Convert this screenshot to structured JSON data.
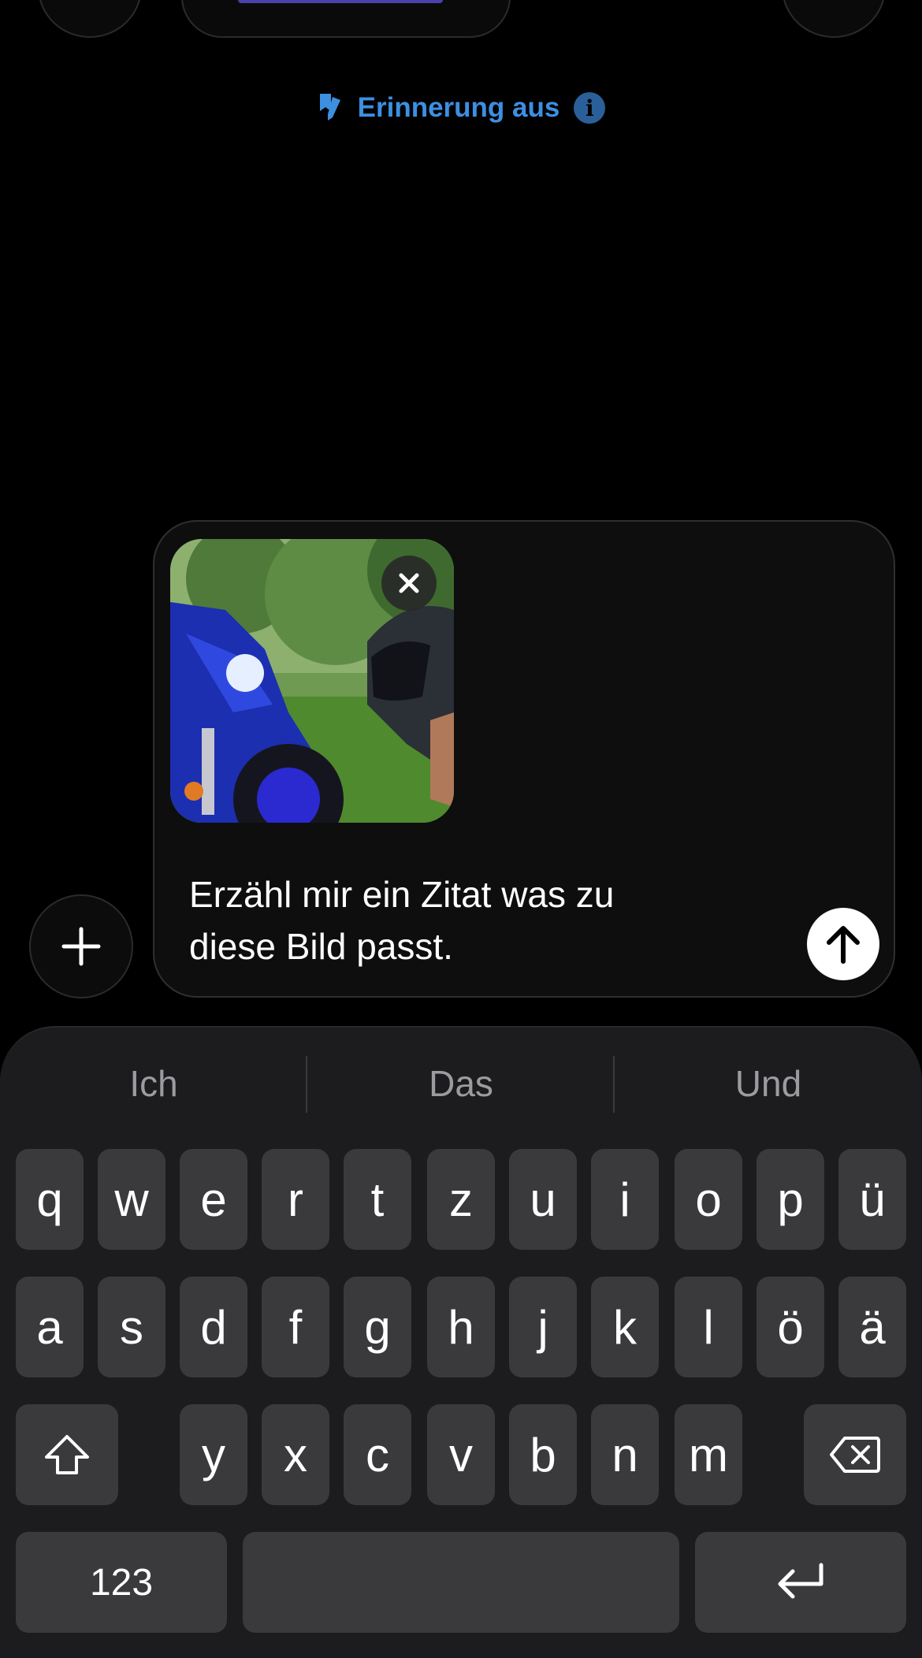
{
  "memory": {
    "label": "Erinnerung aus",
    "icon": "memory-icon"
  },
  "composer": {
    "prompt": "Erzähl mir ein Zitat was zu diese Bild passt.",
    "prompt_line1": "Erzähl mir ein Zitat was zu",
    "prompt_line2": "diese Bild passt."
  },
  "keyboard": {
    "suggestions": [
      "Ich",
      "Das",
      "Und"
    ],
    "row1": [
      "q",
      "w",
      "e",
      "r",
      "t",
      "z",
      "u",
      "i",
      "o",
      "p",
      "ü"
    ],
    "row2": [
      "a",
      "s",
      "d",
      "f",
      "g",
      "h",
      "j",
      "k",
      "l",
      "ö",
      "ä"
    ],
    "row3": [
      "y",
      "x",
      "c",
      "v",
      "b",
      "n",
      "m"
    ],
    "numbers_label": "123"
  },
  "colors": {
    "accent": "#3d8fe0",
    "background": "#000000",
    "key": "#3a3a3c"
  }
}
